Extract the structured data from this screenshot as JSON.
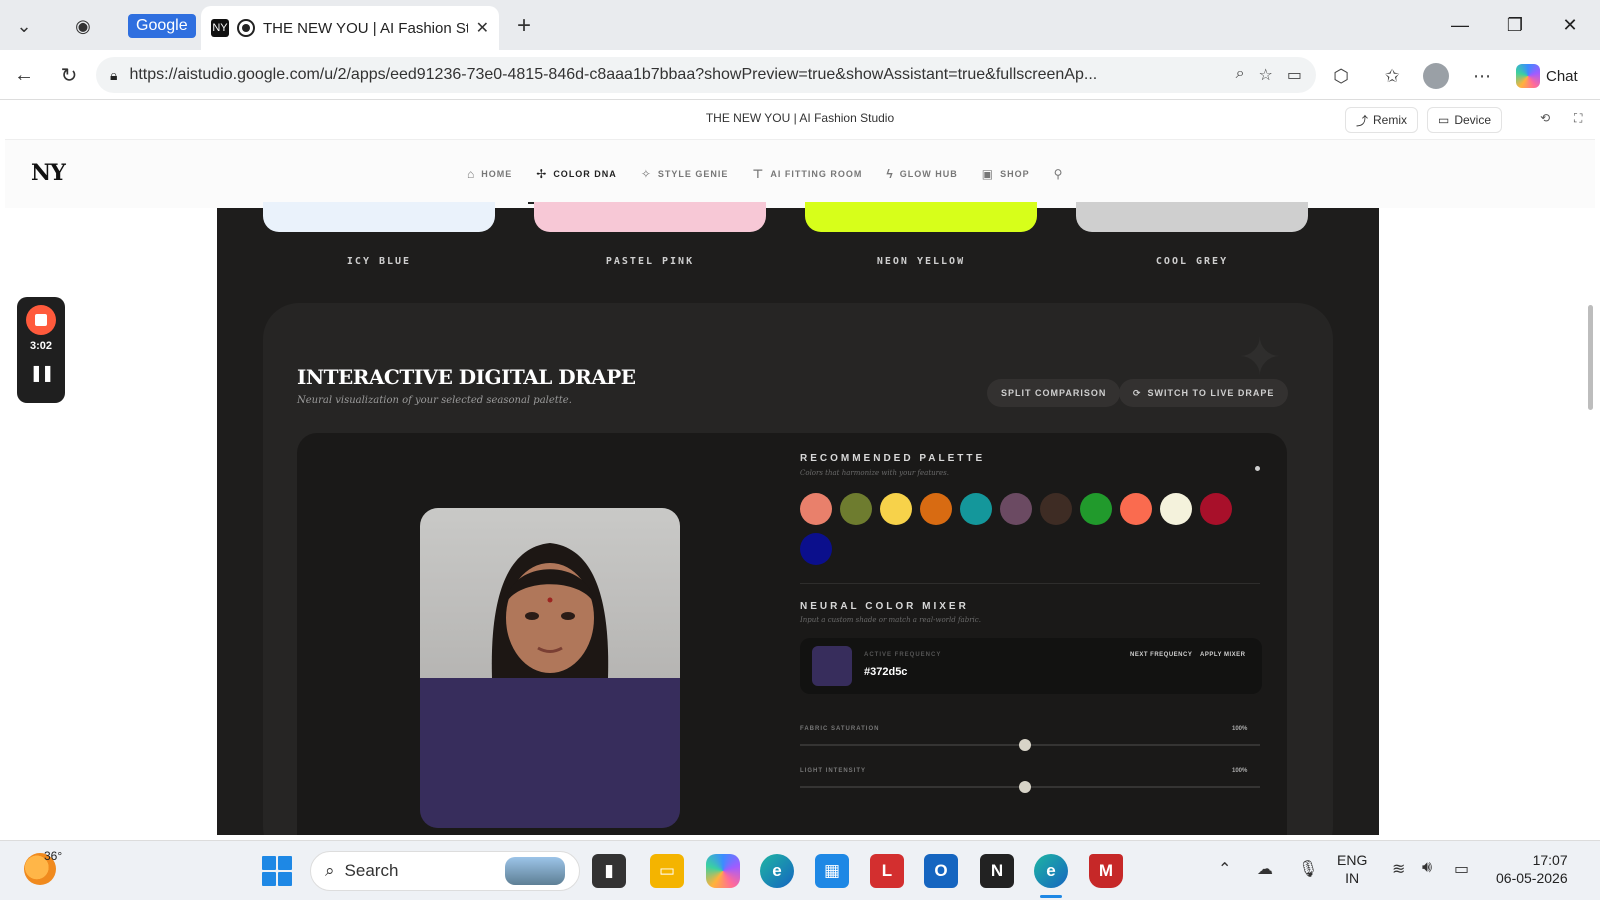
{
  "browser": {
    "google_chip": "Google",
    "tab_title": "THE NEW YOU | AI Fashion Stu",
    "tab_favicon": "NY",
    "new_tab_glyph": "+",
    "url": "https://aistudio.google.com/u/2/apps/eed91236-73e0-4815-846d-c8aaa1b7bbaa?showPreview=true&showAssistant=true&fullscreenAp...",
    "chat_label": "Chat"
  },
  "app_header": {
    "title": "THE NEW YOU | AI Fashion Studio",
    "remix_label": "Remix",
    "device_label": "Device"
  },
  "site": {
    "logo": "NY",
    "nav": [
      {
        "label": "HOME",
        "icon": "home-icon"
      },
      {
        "label": "COLOR DNA",
        "icon": "color-dna-icon",
        "active": true
      },
      {
        "label": "STYLE GENIE",
        "icon": "sparkle-icon"
      },
      {
        "label": "AI FITTING ROOM",
        "icon": "shirt-icon"
      },
      {
        "label": "GLOW HUB",
        "icon": "bolt-icon"
      },
      {
        "label": "SHOP",
        "icon": "bag-icon"
      },
      {
        "label": "",
        "icon": "user-icon"
      }
    ]
  },
  "swatches": [
    {
      "label": "ICY BLUE",
      "color": "#eaf2fb"
    },
    {
      "label": "PASTEL PINK",
      "color": "#f7c8d6"
    },
    {
      "label": "NEON YELLOW",
      "color": "#d7ff1a"
    },
    {
      "label": "COOL GREY",
      "color": "#cfcfcf"
    }
  ],
  "drape": {
    "title": "INTERACTIVE DIGITAL DRAPE",
    "subtitle": "Neural visualization of your selected seasonal palette.",
    "split_label": "SPLIT COMPARISON",
    "live_label": "SWITCH TO LIVE DRAPE",
    "drape_color": "#372d5c"
  },
  "palette": {
    "heading": "RECOMMENDED PALETTE",
    "subheading": "Colors that harmonize with your features.",
    "colors": [
      "#e9806b",
      "#6e7c2f",
      "#f7d24a",
      "#d86b12",
      "#14979b",
      "#6b4a62",
      "#3e2c24",
      "#219a2c",
      "#fa6b4f",
      "#f4f2dc",
      "#a8102a",
      "#0b0f8c"
    ]
  },
  "mixer": {
    "heading": "NEURAL COLOR MIXER",
    "subheading": "Input a custom shade or match a real-world fabric.",
    "active_label": "ACTIVE FREQUENCY",
    "hex": "#372d5c",
    "next_label": "NEXT FREQUENCY",
    "apply_label": "APPLY MIXER"
  },
  "sliders": [
    {
      "label": "FABRIC SATURATION",
      "value_text": "100%",
      "level": 0.49
    },
    {
      "label": "LIGHT INTENSITY",
      "value_text": "100%",
      "level": 0.49
    }
  ],
  "recorder": {
    "time": "3:02"
  },
  "taskbar": {
    "temperature": "36°",
    "search_label": "Search",
    "lang_line1": "ENG",
    "lang_line2": "IN",
    "time": "17:07",
    "date": "06-05-2026"
  }
}
